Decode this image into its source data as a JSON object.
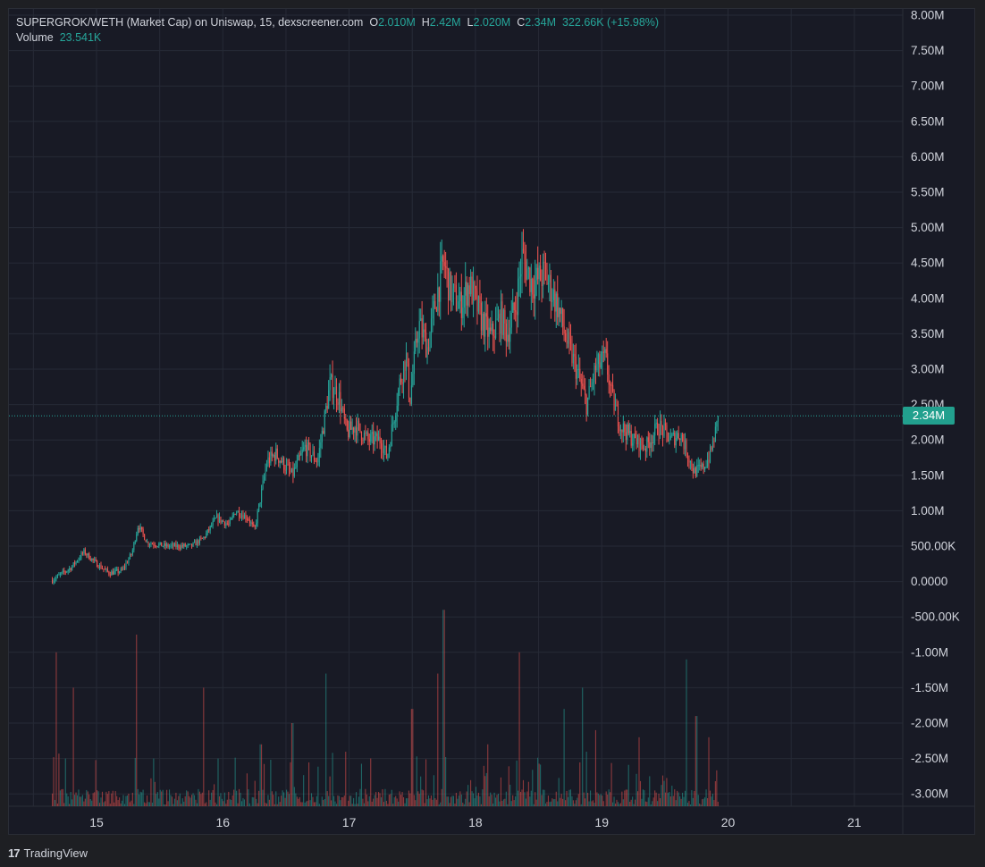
{
  "legend": {
    "symbol": "SUPERGROK/WETH (Market Cap) on Uniswap, 15, dexscreener.com",
    "o_label": "O",
    "o_value": "2.010M",
    "h_label": "H",
    "h_value": "2.42M",
    "l_label": "L",
    "l_value": "2.020M",
    "c_label": "C",
    "c_value": "2.34M",
    "change": "322.66K (+15.98%)",
    "volume_label": "Volume",
    "volume_value": "23.541K"
  },
  "price_tag": "2.34M",
  "footer": {
    "logo_mark": "17",
    "brand": "TradingView"
  },
  "colors": {
    "up": "#26a69a",
    "down": "#ef5350",
    "background": "#181a25",
    "grid": "#262a36",
    "text": "#d1d4dc"
  },
  "chart_data": {
    "type": "candlestick",
    "title": "SUPERGROK/WETH (Market Cap) on Uniswap, 15, dexscreener.com",
    "ylim": [
      -3.2,
      8.1
    ],
    "y_unit": "M",
    "y_ticks": [
      "8.00M",
      "7.50M",
      "7.00M",
      "6.50M",
      "6.00M",
      "5.50M",
      "5.00M",
      "4.50M",
      "4.00M",
      "3.50M",
      "3.00M",
      "2.50M",
      "2.00M",
      "1.50M",
      "1.00M",
      "500.00K",
      "0.0000",
      "-500.00K",
      "-1.00M",
      "-1.50M",
      "-2.00M",
      "-2.50M",
      "-3.00M"
    ],
    "y_tick_values": [
      8.0,
      7.5,
      7.0,
      6.5,
      6.0,
      5.5,
      5.0,
      4.5,
      4.0,
      3.5,
      3.0,
      2.5,
      2.0,
      1.5,
      1.0,
      0.5,
      0.0,
      -0.5,
      -1.0,
      -1.5,
      -2.0,
      -2.5,
      -3.0
    ],
    "x_ticks": [
      "15",
      "16",
      "17",
      "18",
      "19",
      "20",
      "21"
    ],
    "x_tick_values": [
      15,
      16,
      17,
      18,
      19,
      20,
      21
    ],
    "xlim": [
      14.4,
      21.4
    ],
    "grid": true,
    "last_price": 2.34,
    "price_path": [
      [
        14.65,
        0.02
      ],
      [
        14.8,
        0.2
      ],
      [
        14.9,
        0.42
      ],
      [
        15.0,
        0.25
      ],
      [
        15.1,
        0.12
      ],
      [
        15.2,
        0.15
      ],
      [
        15.28,
        0.4
      ],
      [
        15.33,
        0.8
      ],
      [
        15.4,
        0.55
      ],
      [
        15.55,
        0.5
      ],
      [
        15.75,
        0.5
      ],
      [
        15.85,
        0.62
      ],
      [
        15.95,
        0.9
      ],
      [
        16.05,
        0.8
      ],
      [
        16.1,
        1.0
      ],
      [
        16.2,
        0.9
      ],
      [
        16.25,
        0.72
      ],
      [
        16.3,
        1.2
      ],
      [
        16.35,
        1.7
      ],
      [
        16.42,
        1.8
      ],
      [
        16.55,
        1.5
      ],
      [
        16.65,
        1.9
      ],
      [
        16.75,
        1.7
      ],
      [
        16.85,
        2.8
      ],
      [
        16.92,
        2.6
      ],
      [
        16.98,
        2.1
      ],
      [
        17.05,
        2.2
      ],
      [
        17.15,
        2.0
      ],
      [
        17.25,
        2.0
      ],
      [
        17.3,
        1.75
      ],
      [
        17.4,
        2.8
      ],
      [
        17.45,
        3.2
      ],
      [
        17.48,
        2.55
      ],
      [
        17.55,
        3.65
      ],
      [
        17.62,
        3.3
      ],
      [
        17.7,
        4.1
      ],
      [
        17.75,
        4.5
      ],
      [
        17.8,
        4.1
      ],
      [
        17.88,
        3.9
      ],
      [
        17.95,
        4.2
      ],
      [
        18.05,
        3.7
      ],
      [
        18.12,
        3.45
      ],
      [
        18.2,
        3.75
      ],
      [
        18.25,
        3.5
      ],
      [
        18.32,
        3.9
      ],
      [
        18.37,
        4.6
      ],
      [
        18.45,
        4.2
      ],
      [
        18.55,
        4.35
      ],
      [
        18.65,
        3.9
      ],
      [
        18.72,
        3.4
      ],
      [
        18.8,
        3.0
      ],
      [
        18.88,
        2.5
      ],
      [
        18.95,
        3.0
      ],
      [
        19.03,
        3.15
      ],
      [
        19.08,
        2.6
      ],
      [
        19.15,
        2.2
      ],
      [
        19.25,
        2.0
      ],
      [
        19.35,
        1.9
      ],
      [
        19.45,
        2.2
      ],
      [
        19.55,
        2.0
      ],
      [
        19.62,
        2.1
      ],
      [
        19.68,
        1.8
      ],
      [
        19.73,
        1.55
      ],
      [
        19.8,
        1.6
      ],
      [
        19.86,
        1.8
      ],
      [
        19.93,
        2.34
      ]
    ],
    "volume_peaks": [
      [
        14.68,
        -1.0
      ],
      [
        14.75,
        -2.5
      ],
      [
        14.82,
        -1.5
      ],
      [
        15.32,
        -0.75
      ],
      [
        15.45,
        -2.5
      ],
      [
        15.85,
        -1.5
      ],
      [
        16.3,
        -2.3
      ],
      [
        16.55,
        -2.0
      ],
      [
        16.82,
        -1.3
      ],
      [
        17.5,
        -1.8
      ],
      [
        17.75,
        -0.4
      ],
      [
        17.7,
        -1.3
      ],
      [
        18.1,
        -2.3
      ],
      [
        18.35,
        -1.0
      ],
      [
        18.7,
        -1.8
      ],
      [
        18.85,
        -1.5
      ],
      [
        18.95,
        -2.1
      ],
      [
        19.3,
        -2.2
      ],
      [
        19.67,
        -1.1
      ],
      [
        19.75,
        -1.9
      ],
      [
        19.85,
        -2.2
      ]
    ]
  }
}
